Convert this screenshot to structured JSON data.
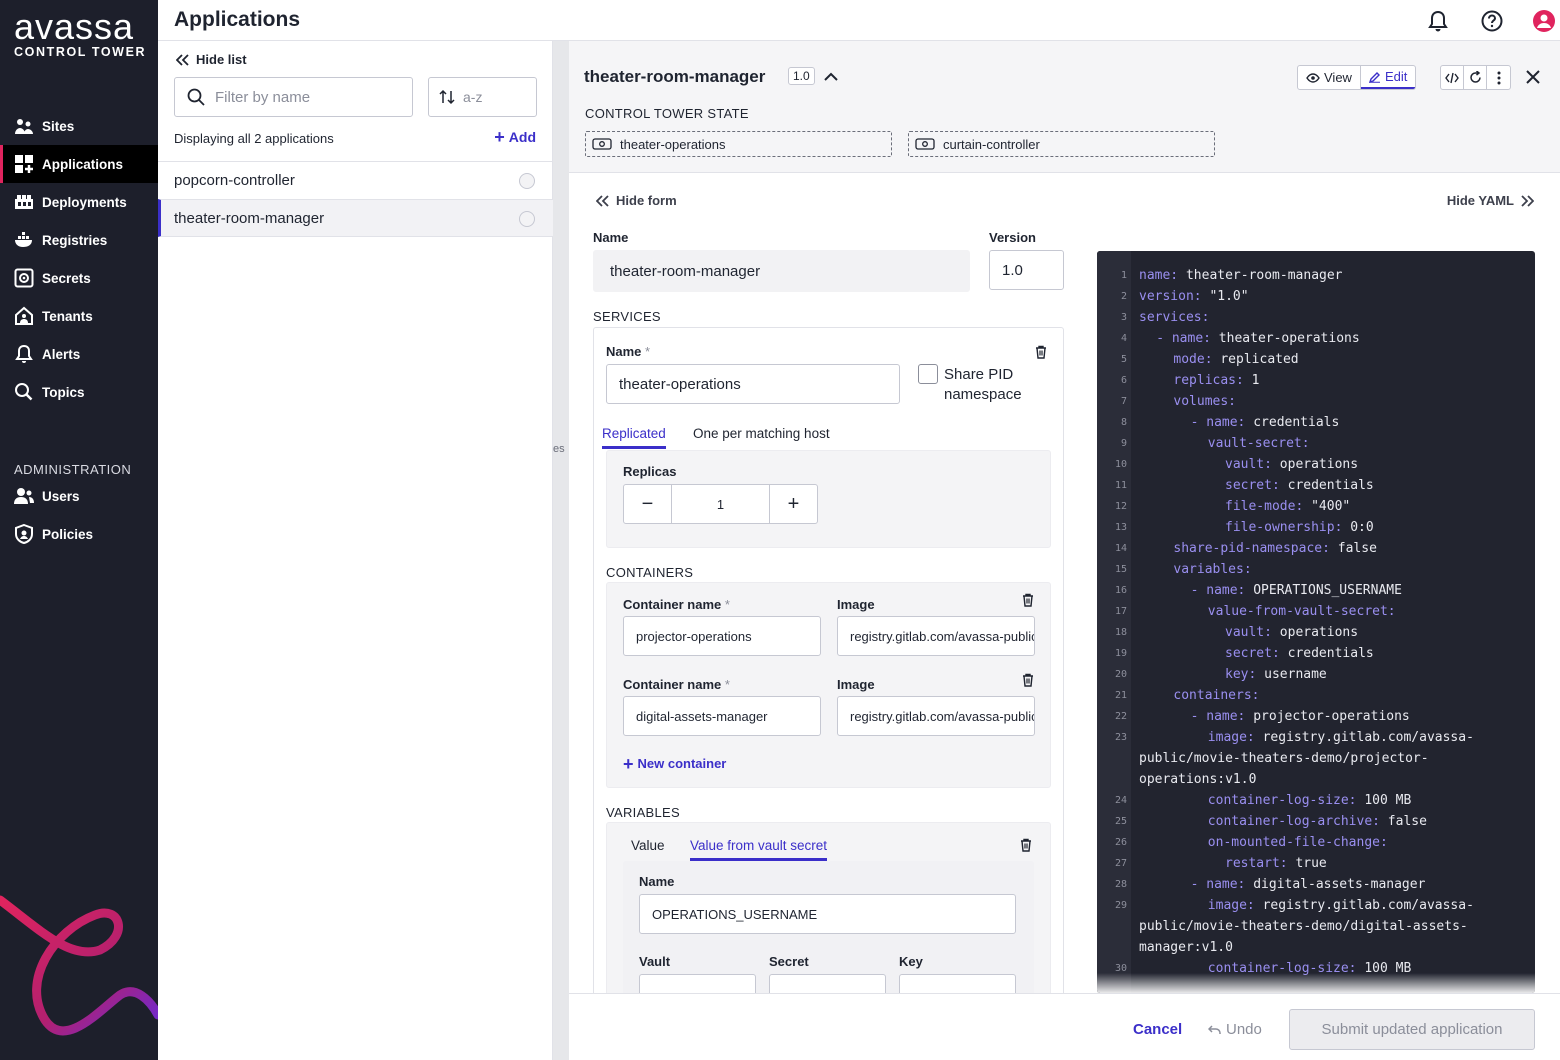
{
  "brand": {
    "logo_text": "avassa",
    "logo_sub": "CONTROL TOWER",
    "accent": "#e0245e",
    "primary": "#3b2fc9"
  },
  "nav": {
    "items": [
      {
        "label": "Sites",
        "icon": "sites-icon"
      },
      {
        "label": "Applications",
        "icon": "applications-icon",
        "active": true
      },
      {
        "label": "Deployments",
        "icon": "deployments-icon"
      },
      {
        "label": "Registries",
        "icon": "registries-icon"
      },
      {
        "label": "Secrets",
        "icon": "secrets-icon"
      },
      {
        "label": "Tenants",
        "icon": "tenants-icon"
      },
      {
        "label": "Alerts",
        "icon": "alerts-icon"
      },
      {
        "label": "Topics",
        "icon": "topics-icon"
      }
    ],
    "admin_heading": "ADMINISTRATION",
    "admin_items": [
      {
        "label": "Users",
        "icon": "users-icon"
      },
      {
        "label": "Policies",
        "icon": "policies-icon"
      }
    ]
  },
  "header": {
    "title": "Applications"
  },
  "list": {
    "hide_label": "Hide list",
    "filter_placeholder": "Filter by name",
    "sort_value": "a-z",
    "summary": "Displaying all 2 applications",
    "add_label": "Add",
    "items": [
      {
        "name": "popcorn-controller",
        "selected": false
      },
      {
        "name": "theater-room-manager",
        "selected": true
      }
    ]
  },
  "map": {
    "fragment_text": "es"
  },
  "detail": {
    "title": "theater-room-manager",
    "version_badge": "1.0",
    "view_label": "View",
    "edit_label": "Edit",
    "ct_state_heading": "CONTROL TOWER STATE",
    "ct_state_services": [
      "theater-operations",
      "curtain-controller"
    ],
    "hide_form": "Hide form",
    "hide_yaml": "Hide YAML",
    "form": {
      "name_label": "Name",
      "name_value": "theater-room-manager",
      "version_label": "Version",
      "version_value": "1.0",
      "services_heading": "SERVICES",
      "service": {
        "name_label": "Name",
        "required_mark": "*",
        "name_value": "theater-operations",
        "share_pid_label_1": "Share PID",
        "share_pid_label_2": "namespace",
        "tab_replicated": "Replicated",
        "tab_one_per_host": "One per matching host",
        "replicas_label": "Replicas",
        "replicas_value": "1",
        "minus": "−",
        "plus": "+"
      },
      "containers_heading": "CONTAINERS",
      "containers": [
        {
          "name_label": "Container name",
          "image_label": "Image",
          "name": "projector-operations",
          "image": "registry.gitlab.com/avassa-public/movie-theaters-demo/projector-operations:v1.0"
        },
        {
          "name_label": "Container name",
          "image_label": "Image",
          "name": "digital-assets-manager",
          "image": "registry.gitlab.com/avassa-public/movie-theaters-demo/digital-assets-manager:v1.0"
        }
      ],
      "new_container_label": "New container",
      "variables_heading": "VARIABLES",
      "variable": {
        "tab_value": "Value",
        "tab_vault": "Value from vault secret",
        "name_label": "Name",
        "name_value": "OPERATIONS_USERNAME",
        "vault_label": "Vault",
        "secret_label": "Secret",
        "key_label": "Key"
      }
    },
    "yaml_lines": [
      {
        "n": "1",
        "i": 0,
        "dash": false,
        "k": "name:",
        "v": " theater-room-manager"
      },
      {
        "n": "2",
        "i": 0,
        "dash": false,
        "k": "version:",
        "v": " \"1.0\""
      },
      {
        "n": "3",
        "i": 0,
        "dash": false,
        "k": "services:",
        "v": ""
      },
      {
        "n": "4",
        "i": 1,
        "dash": true,
        "k": "name:",
        "v": " theater-operations"
      },
      {
        "n": "5",
        "i": 2,
        "dash": false,
        "k": "mode:",
        "v": " replicated"
      },
      {
        "n": "6",
        "i": 2,
        "dash": false,
        "k": "replicas:",
        "v": " 1"
      },
      {
        "n": "7",
        "i": 2,
        "dash": false,
        "k": "volumes:",
        "v": ""
      },
      {
        "n": "8",
        "i": 3,
        "dash": true,
        "k": "name:",
        "v": " credentials"
      },
      {
        "n": "9",
        "i": 4,
        "dash": false,
        "k": "vault-secret:",
        "v": ""
      },
      {
        "n": "10",
        "i": 5,
        "dash": false,
        "k": "vault:",
        "v": " operations"
      },
      {
        "n": "11",
        "i": 5,
        "dash": false,
        "k": "secret:",
        "v": " credentials"
      },
      {
        "n": "12",
        "i": 5,
        "dash": false,
        "k": "file-mode:",
        "v": " \"400\""
      },
      {
        "n": "13",
        "i": 5,
        "dash": false,
        "k": "file-ownership:",
        "v": " 0:0"
      },
      {
        "n": "14",
        "i": 2,
        "dash": false,
        "k": "share-pid-namespace:",
        "v": " false"
      },
      {
        "n": "15",
        "i": 2,
        "dash": false,
        "k": "variables:",
        "v": ""
      },
      {
        "n": "16",
        "i": 3,
        "dash": true,
        "k": "name:",
        "v": " OPERATIONS_USERNAME"
      },
      {
        "n": "17",
        "i": 4,
        "dash": false,
        "k": "value-from-vault-secret:",
        "v": ""
      },
      {
        "n": "18",
        "i": 5,
        "dash": false,
        "k": "vault:",
        "v": " operations"
      },
      {
        "n": "19",
        "i": 5,
        "dash": false,
        "k": "secret:",
        "v": " credentials"
      },
      {
        "n": "20",
        "i": 5,
        "dash": false,
        "k": "key:",
        "v": " username"
      },
      {
        "n": "21",
        "i": 2,
        "dash": false,
        "k": "containers:",
        "v": ""
      },
      {
        "n": "22",
        "i": 3,
        "dash": true,
        "k": "name:",
        "v": " projector-operations"
      },
      {
        "n": "23",
        "i": 4,
        "dash": false,
        "k": "image:",
        "v": " registry.gitlab.com/avassa-"
      },
      {
        "n": "",
        "i": 0,
        "dash": false,
        "k": "",
        "v": "public/movie-theaters-demo/projector-"
      },
      {
        "n": "",
        "i": 0,
        "dash": false,
        "k": "",
        "v": "operations:v1.0"
      },
      {
        "n": "24",
        "i": 4,
        "dash": false,
        "k": "container-log-size:",
        "v": " 100 MB"
      },
      {
        "n": "25",
        "i": 4,
        "dash": false,
        "k": "container-log-archive:",
        "v": " false"
      },
      {
        "n": "26",
        "i": 4,
        "dash": false,
        "k": "on-mounted-file-change:",
        "v": ""
      },
      {
        "n": "27",
        "i": 5,
        "dash": false,
        "k": "restart:",
        "v": " true"
      },
      {
        "n": "28",
        "i": 3,
        "dash": true,
        "k": "name:",
        "v": " digital-assets-manager"
      },
      {
        "n": "29",
        "i": 4,
        "dash": false,
        "k": "image:",
        "v": " registry.gitlab.com/avassa-"
      },
      {
        "n": "",
        "i": 0,
        "dash": false,
        "k": "",
        "v": "public/movie-theaters-demo/digital-assets-"
      },
      {
        "n": "",
        "i": 0,
        "dash": false,
        "k": "",
        "v": "manager:v1.0"
      },
      {
        "n": "30",
        "i": 4,
        "dash": false,
        "k": "container-log-size:",
        "v": " 100 MB"
      }
    ]
  },
  "footer": {
    "cancel_label": "Cancel",
    "undo_label": "Undo",
    "submit_label": "Submit updated application"
  }
}
